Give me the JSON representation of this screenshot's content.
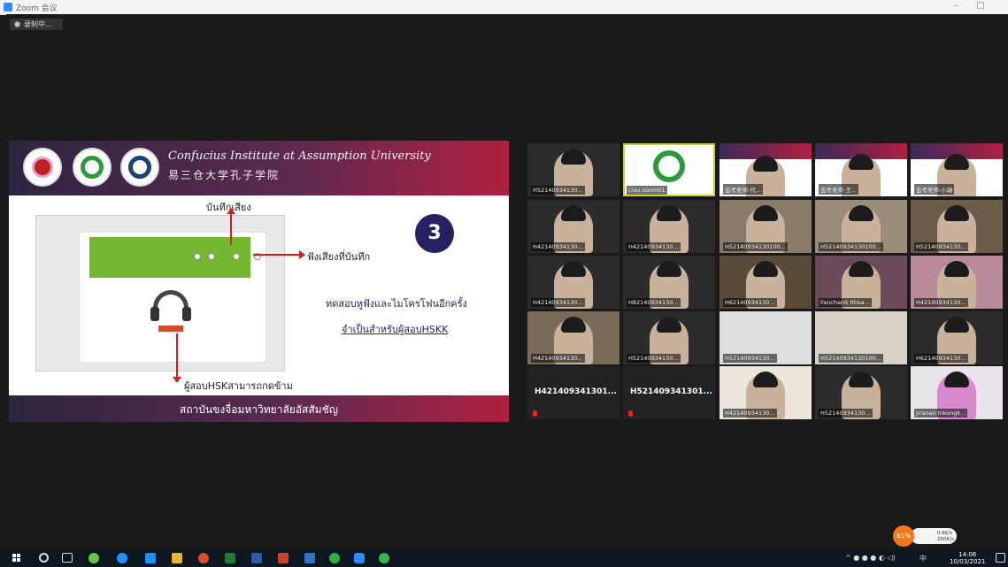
{
  "window": {
    "title": "Zoom 会议",
    "minimize": "–",
    "restore": "□"
  },
  "recording": {
    "label": "录制中..."
  },
  "slide": {
    "institute_en": "Confucius Institute at Assumption University",
    "institute_zh": "易三仓大学孔子学院",
    "step_number": "3",
    "label_record": "บันทึกเสียง",
    "label_playback": "ฟังเสียงที่บันทึก",
    "label_skip": "ผู้สอบHSKสามารถกดข้าม",
    "note_1": "ทดสอบหูฟังและไมโครโฟนอีกครั้ง",
    "note_2": "จำเป็นสำหรับผู้สอบHSKK",
    "footer": "สถาบันขงจื่อมหาวิทยาลัยอัสสัมชัญ"
  },
  "participants": [
    {
      "name": "H52140934130..."
    },
    {
      "name": "ciau zoom01"
    },
    {
      "name": "监考老师-代..."
    },
    {
      "name": "监考老师-王..."
    },
    {
      "name": "监考老师-小瑞"
    },
    {
      "name": "H42140934130..."
    },
    {
      "name": "H42140934130..."
    },
    {
      "name": "H52140934130100..."
    },
    {
      "name": "H52140934130100..."
    },
    {
      "name": "H52140934130..."
    },
    {
      "name": "H42140934130..."
    },
    {
      "name": "H82140934130..."
    },
    {
      "name": "H62140934130..."
    },
    {
      "name": "Fanchanit Ittisa..."
    },
    {
      "name": "H42140934130..."
    },
    {
      "name": "H42140934130..."
    },
    {
      "name": "H52140934130..."
    },
    {
      "name": "H52140934130..."
    },
    {
      "name": "H52140934130100..."
    },
    {
      "name": "H62140934130..."
    },
    {
      "name": "H421409341301..."
    },
    {
      "name": "H521409341301..."
    },
    {
      "name": "H42140934130..."
    },
    {
      "name": "H52140934130..."
    },
    {
      "name": "Jiranan Inkongk..."
    }
  ],
  "network": {
    "percent": "61%",
    "up": "0.6K/s",
    "down": "250K/s"
  },
  "taskbar": {
    "time": "14:06",
    "date": "10/03/2021",
    "lang": "中"
  }
}
